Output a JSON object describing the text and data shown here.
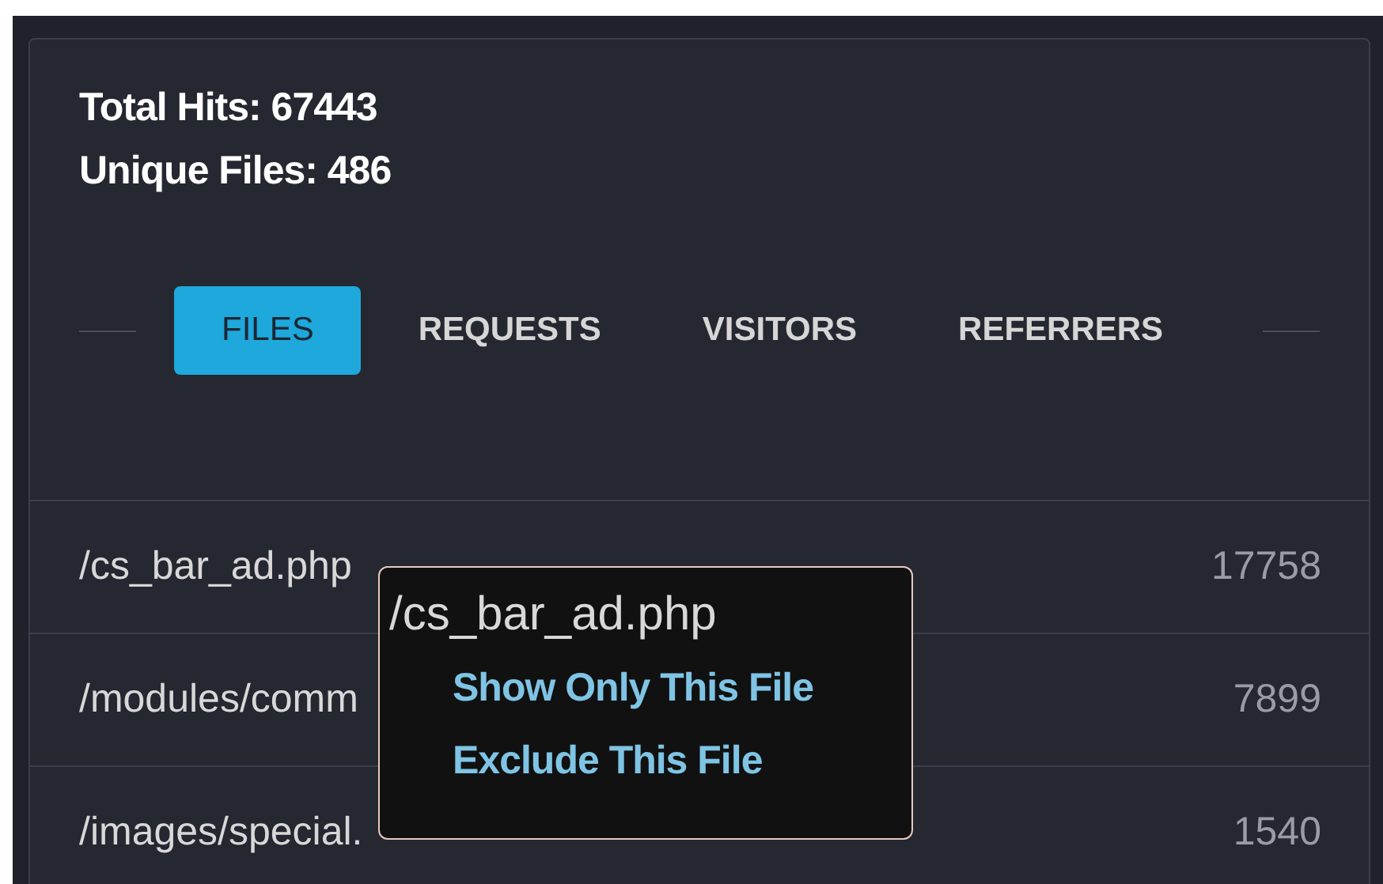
{
  "stats": [
    {
      "text": "Total Hits: 67443"
    },
    {
      "text": "Unique Files: 486"
    }
  ],
  "tabs": [
    {
      "label": "FILES",
      "selected": true
    },
    {
      "label": "REQUESTS",
      "selected": false
    },
    {
      "label": "VISITORS",
      "selected": false
    },
    {
      "label": "REFERRERS",
      "selected": false
    }
  ],
  "rows": [
    {
      "path": "/cs_bar_ad.php",
      "count": "17758"
    },
    {
      "path": "/modules/comm",
      "count": "7899"
    },
    {
      "path": "/images/special.",
      "count": "1540"
    }
  ],
  "context_menu": {
    "title": "/cs_bar_ad.php",
    "items": [
      "Show Only This File",
      "Exclude This File"
    ]
  }
}
